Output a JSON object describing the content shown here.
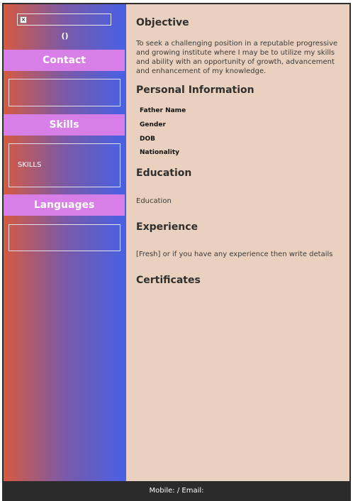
{
  "sidebar": {
    "photo_icon": "broken-image-icon",
    "name_line": "()",
    "contact_heading": "Contact",
    "skills_heading": "Skills",
    "skills_text": "SKILLS",
    "languages_heading": "Languages"
  },
  "main": {
    "objective_heading": "Objective",
    "objective_text": "To seek a challenging position in a reputable progressive and growing institute where I may be to utilize my skills and ability with an opportunity of growth, advancement and enhancement of my knowledge.",
    "personal_heading": "Personal Information",
    "personal_fields": [
      "Father Name",
      "Gender",
      "DOB",
      "Nationality"
    ],
    "education_heading": "Education",
    "education_text": "Education",
    "experience_heading": "Experience",
    "experience_text": "[Fresh] or if you have any experience then write details",
    "certificates_heading": "Certificates"
  },
  "footer": {
    "text": "Mobile: / Email:"
  },
  "colors": {
    "sidebar_gradient_start": "#d65a41",
    "sidebar_gradient_end": "#4860e6",
    "heading_bar": "#d77fe6",
    "page_background": "#ead1bf",
    "footer_background": "#2b2b2b"
  }
}
